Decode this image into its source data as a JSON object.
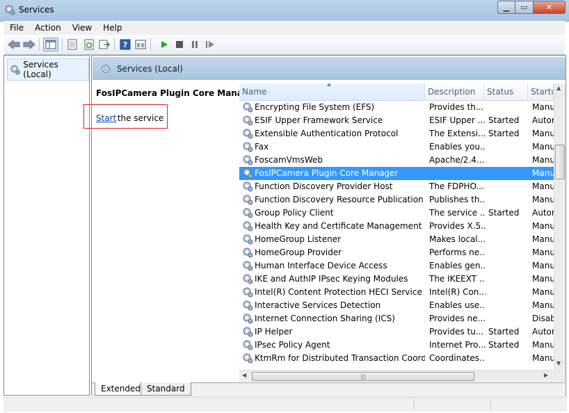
{
  "window": {
    "title": "Services"
  },
  "menu": [
    "File",
    "Action",
    "View",
    "Help"
  ],
  "toolbar": {
    "icons": [
      "back-arrow-icon",
      "forward-arrow-icon",
      "show-hide-console-tree-icon",
      "properties-icon",
      "refresh-icon",
      "export-list-icon",
      "help-icon",
      "console-view-icon",
      "start-service-icon",
      "stop-service-icon",
      "pause-service-icon",
      "restart-service-icon"
    ]
  },
  "tree": {
    "item": "Services (Local)"
  },
  "main": {
    "header": "Services (Local)",
    "selected_service": "FosIPCamera Plugin Core Manager",
    "start_link": "Start",
    "start_suffix": " the service"
  },
  "columns": [
    "Name",
    "Description",
    "Status",
    "Startu"
  ],
  "services": [
    {
      "name": "Encrypting File System (EFS)",
      "desc": "Provides th...",
      "status": "",
      "startup": "Manu"
    },
    {
      "name": "ESIF Upper Framework Service",
      "desc": "ESIF Upper ...",
      "status": "Started",
      "startup": "Autor"
    },
    {
      "name": "Extensible Authentication Protocol",
      "desc": "The Extensi...",
      "status": "Started",
      "startup": "Manu"
    },
    {
      "name": "Fax",
      "desc": "Enables you...",
      "status": "",
      "startup": "Manu"
    },
    {
      "name": "FoscamVmsWeb",
      "desc": "Apache/2.4....",
      "status": "",
      "startup": "Manu"
    },
    {
      "name": "FosIPCamera Plugin Core Manager",
      "desc": "",
      "status": "",
      "startup": "Manu",
      "selected": true
    },
    {
      "name": "Function Discovery Provider Host",
      "desc": "The FDPHO...",
      "status": "",
      "startup": "Manu"
    },
    {
      "name": "Function Discovery Resource Publication",
      "desc": "Publishes th...",
      "status": "",
      "startup": "Manu"
    },
    {
      "name": "Group Policy Client",
      "desc": "The service ...",
      "status": "Started",
      "startup": "Autor"
    },
    {
      "name": "Health Key and Certificate Management",
      "desc": "Provides X.5...",
      "status": "",
      "startup": "Manu"
    },
    {
      "name": "HomeGroup Listener",
      "desc": "Makes local...",
      "status": "",
      "startup": "Manu"
    },
    {
      "name": "HomeGroup Provider",
      "desc": "Performs ne...",
      "status": "",
      "startup": "Manu"
    },
    {
      "name": "Human Interface Device Access",
      "desc": "Enables gen...",
      "status": "",
      "startup": "Manu"
    },
    {
      "name": "IKE and AuthIP IPsec Keying Modules",
      "desc": "The IKEEXT ...",
      "status": "",
      "startup": "Manu"
    },
    {
      "name": "Intel(R) Content Protection HECI Service",
      "desc": "Intel(R) Con...",
      "status": "",
      "startup": "Manu"
    },
    {
      "name": "Interactive Services Detection",
      "desc": "Enables use...",
      "status": "",
      "startup": "Manu"
    },
    {
      "name": "Internet Connection Sharing (ICS)",
      "desc": "Provides ne...",
      "status": "",
      "startup": "Disabl"
    },
    {
      "name": "IP Helper",
      "desc": "Provides tu...",
      "status": "Started",
      "startup": "Autor"
    },
    {
      "name": "IPsec Policy Agent",
      "desc": "Internet Pro...",
      "status": "Started",
      "startup": "Manu"
    },
    {
      "name": "KtmRm for Distributed Transaction Coordin...",
      "desc": "Coordinates...",
      "status": "",
      "startup": "Manu"
    }
  ],
  "tabs": [
    "Extended",
    "Standard"
  ],
  "colors": {
    "selection": "#3399ff",
    "link": "#0645ad",
    "highlight_box": "#e02020",
    "header_gradient_top": "#c5d8ec"
  }
}
